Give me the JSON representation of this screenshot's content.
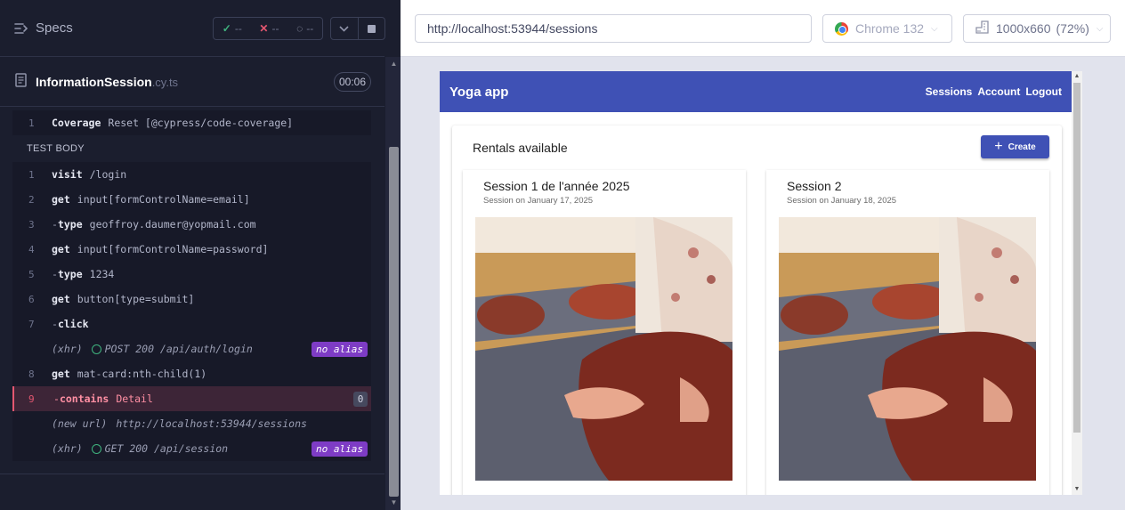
{
  "runner": {
    "specs_label": "Specs",
    "stats": {
      "passed": "--",
      "failed": "--",
      "pending": "--"
    },
    "file": {
      "name": "InformationSession",
      "ext": ".cy.ts",
      "duration": "00:06"
    },
    "hook": {
      "num": "1",
      "name": "Coverage",
      "arg": "Reset [@cypress/code-coverage]"
    },
    "section_label": "TEST BODY",
    "commands": [
      {
        "num": "1",
        "dash": "",
        "name": "visit",
        "arg": "/login"
      },
      {
        "num": "2",
        "dash": "",
        "name": "get",
        "arg": "input[formControlName=email]"
      },
      {
        "num": "3",
        "dash": "-",
        "name": "type",
        "arg": "geoffroy.daumer@yopmail.com"
      },
      {
        "num": "4",
        "dash": "",
        "name": "get",
        "arg": "input[formControlName=password]"
      },
      {
        "num": "5",
        "dash": "-",
        "name": "type",
        "arg": "1234"
      },
      {
        "num": "6",
        "dash": "",
        "name": "get",
        "arg": "button[type=submit]"
      },
      {
        "num": "7",
        "dash": "-",
        "name": "click",
        "arg": ""
      }
    ],
    "xhr1": {
      "label": "(xhr)",
      "text": "POST 200 /api/auth/login",
      "alias": "no alias"
    },
    "cmd8": {
      "num": "8",
      "name": "get",
      "arg": "mat-card:nth-child(1)"
    },
    "failing": {
      "num": "9",
      "dash": "-",
      "name": "contains",
      "arg": "Detail",
      "count": "0"
    },
    "newurl": {
      "label": "(new url)",
      "text": "http://localhost:53944/sessions"
    },
    "xhr2": {
      "label": "(xhr)",
      "text": "GET 200 /api/session",
      "alias": "no alias"
    }
  },
  "browser": {
    "url": "http://localhost:53944/sessions",
    "browser_name": "Chrome 132",
    "viewport": "1000x660",
    "zoom": "(72%)"
  },
  "app": {
    "title": "Yoga app",
    "nav": [
      "Sessions",
      "Account",
      "Logout"
    ],
    "list_title": "Rentals available",
    "create_label": "Create",
    "sessions": [
      {
        "title": "Session 1 de l'année 2025",
        "subtitle": "Session on January 17, 2025"
      },
      {
        "title": "Session 2",
        "subtitle": "Session on January 18, 2025"
      }
    ]
  },
  "colors": {
    "primary": "#3f51b5",
    "pass": "#3fb37e",
    "fail": "#e45770",
    "alias": "#7e3cc5"
  }
}
